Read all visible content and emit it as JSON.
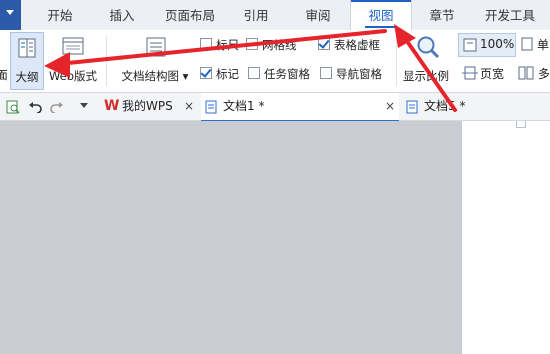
{
  "menu": {
    "tabs": [
      "开始",
      "插入",
      "页面布局",
      "引用",
      "审阅",
      "视图",
      "章节",
      "开发工具"
    ],
    "active_tab": "视图"
  },
  "ribbon": {
    "outline_btn": "大纲",
    "partial_left": "面",
    "web_layout_btn": "Web版式",
    "doc_structure_btn": "文档结构图",
    "ruler_chk": "标尺",
    "gridlines_chk": "网格线",
    "table_gridlines_chk": "表格虚框",
    "marks_chk": "标记",
    "taskpane_chk": "任务窗格",
    "navpane_chk": "导航窗格",
    "display_ratio_btn": "显示比例",
    "zoom_value": "100%",
    "page_width_btn": "页宽",
    "single_page_btn": "单",
    "multi_page_btn": "多"
  },
  "docbar": {
    "tabs": [
      {
        "label": "我的WPS",
        "close": "×"
      },
      {
        "label": "文档1 *",
        "close": "×"
      },
      {
        "label": "文档5 *",
        "close": ""
      }
    ]
  },
  "colors": {
    "accent": "#1e63c4",
    "annotation_arrow": "#e5252b",
    "workspace": "#c9ccd3"
  }
}
